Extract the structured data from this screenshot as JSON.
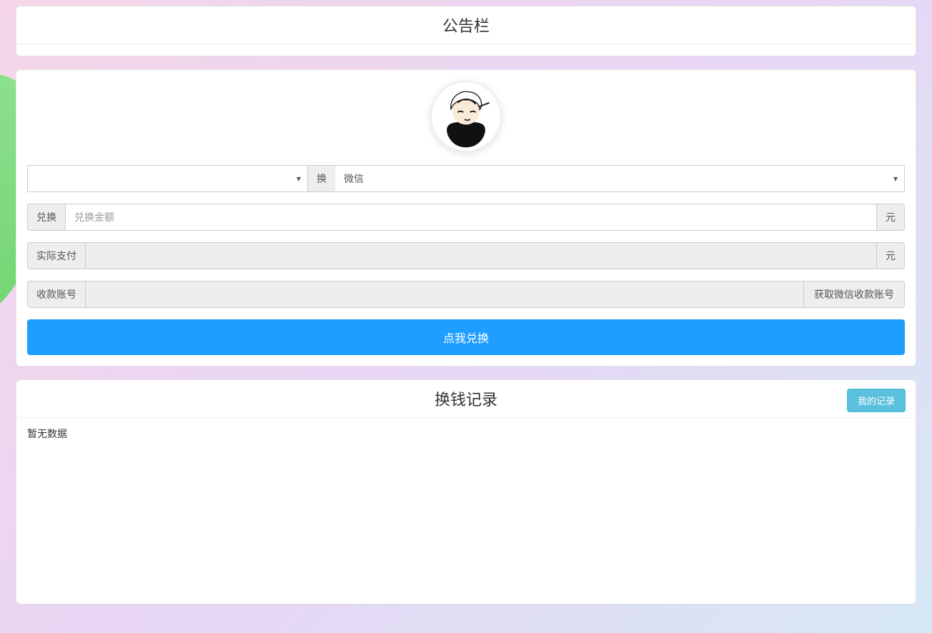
{
  "announce": {
    "title": "公告栏"
  },
  "avatar": {
    "name": "user-avatar"
  },
  "exchangeRow": {
    "fromSelected": "",
    "swapLabel": "换",
    "toSelected": "微信"
  },
  "amount": {
    "prefix": "兑换",
    "placeholder": "兑换金额",
    "value": "",
    "suffix": "元"
  },
  "actualPay": {
    "prefix": "实际支付",
    "value": "",
    "suffix": "元"
  },
  "account": {
    "prefix": "收款账号",
    "value": "",
    "fetchBtn": "获取微信收款账号"
  },
  "submit": {
    "label": "点我兑换"
  },
  "records": {
    "title": "换钱记录",
    "myRecordsBtn": "我的记录",
    "empty": "暂无数据"
  }
}
